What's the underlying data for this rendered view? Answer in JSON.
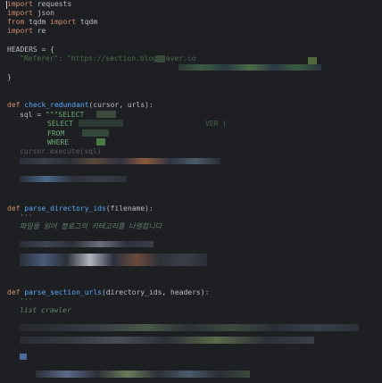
{
  "code": {
    "l1_kw": "import",
    "l1_mod": " requests",
    "l2_kw": "import",
    "l2_mod": " json",
    "l3_from": "from",
    "l3_mod": " tqdm ",
    "l3_import": "import",
    "l3_name": " tqdm",
    "l4_kw": "import",
    "l4_mod": " re",
    "headers_decl": "HEADERS = {",
    "headers_referer": "\"Referer\": \"https://section.blog.naver.co",
    "headers_close": "}",
    "def1_kw": "def ",
    "def1_name": "check_redundant",
    "def1_args": "(cursor, urls):",
    "sql_var": "sql = ",
    "sql_open": "\"\"\"SELECT ",
    "sql_select": "SELECT ",
    "sql_over": "VER (",
    "sql_from": "FROM ",
    "sql_where": "WHERE ",
    "cursor_exec": "cursor.execute(sql)",
    "def2_kw": "def ",
    "def2_name": "parse_directory_ids",
    "def2_args": "(filename):",
    "doc_open": "'''",
    "doc_korean": "파일을 읽어 블로그의 카테고리를 나열합니다",
    "def3_kw": "def ",
    "def3_name": "parse_section_urls",
    "def3_args": "(directory_ids, headers):",
    "doc3_open": "'''",
    "doc3_text": "list crawler"
  },
  "colors": {
    "background": "#1e1f22",
    "keyword": "#cf8e6d",
    "function": "#56a8f5",
    "string": "#6aab73",
    "comment": "#5f826b",
    "text": "#bcbec4"
  }
}
